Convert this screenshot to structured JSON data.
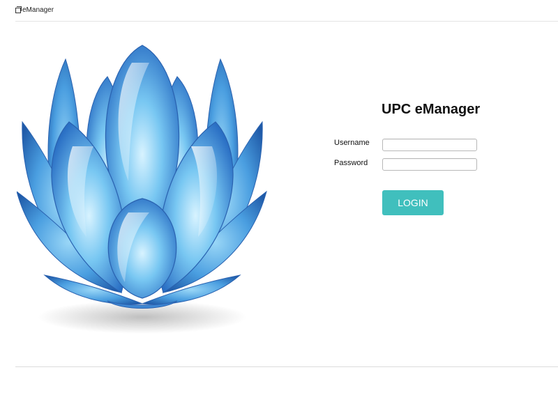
{
  "window": {
    "title": "eManager",
    "icon": "window-icon"
  },
  "brand": {
    "logo": "upc-lotus-logo",
    "accent": "#40bfbd"
  },
  "login": {
    "title": "UPC eManager",
    "username_label": "Username",
    "username_value": "",
    "password_label": "Password",
    "password_value": "",
    "submit_label": "LOGIN"
  }
}
